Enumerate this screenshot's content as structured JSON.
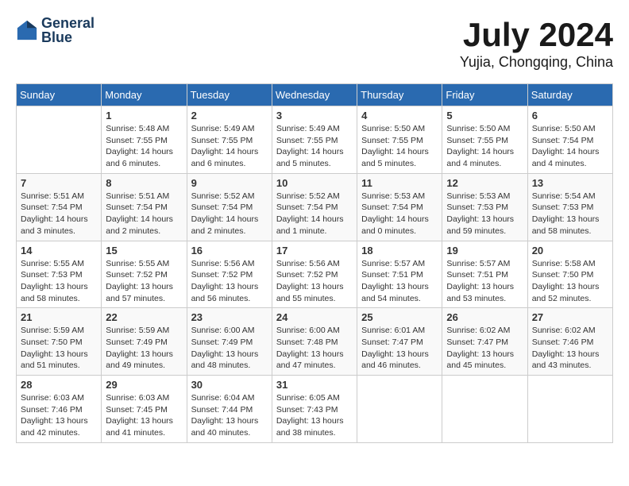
{
  "header": {
    "logo_line1": "General",
    "logo_line2": "Blue",
    "title": "July 2024",
    "subtitle": "Yujia, Chongqing, China"
  },
  "calendar": {
    "days_of_week": [
      "Sunday",
      "Monday",
      "Tuesday",
      "Wednesday",
      "Thursday",
      "Friday",
      "Saturday"
    ],
    "weeks": [
      [
        {
          "day": "",
          "info": ""
        },
        {
          "day": "1",
          "info": "Sunrise: 5:48 AM\nSunset: 7:55 PM\nDaylight: 14 hours\nand 6 minutes."
        },
        {
          "day": "2",
          "info": "Sunrise: 5:49 AM\nSunset: 7:55 PM\nDaylight: 14 hours\nand 6 minutes."
        },
        {
          "day": "3",
          "info": "Sunrise: 5:49 AM\nSunset: 7:55 PM\nDaylight: 14 hours\nand 5 minutes."
        },
        {
          "day": "4",
          "info": "Sunrise: 5:50 AM\nSunset: 7:55 PM\nDaylight: 14 hours\nand 5 minutes."
        },
        {
          "day": "5",
          "info": "Sunrise: 5:50 AM\nSunset: 7:55 PM\nDaylight: 14 hours\nand 4 minutes."
        },
        {
          "day": "6",
          "info": "Sunrise: 5:50 AM\nSunset: 7:54 PM\nDaylight: 14 hours\nand 4 minutes."
        }
      ],
      [
        {
          "day": "7",
          "info": "Sunrise: 5:51 AM\nSunset: 7:54 PM\nDaylight: 14 hours\nand 3 minutes."
        },
        {
          "day": "8",
          "info": "Sunrise: 5:51 AM\nSunset: 7:54 PM\nDaylight: 14 hours\nand 2 minutes."
        },
        {
          "day": "9",
          "info": "Sunrise: 5:52 AM\nSunset: 7:54 PM\nDaylight: 14 hours\nand 2 minutes."
        },
        {
          "day": "10",
          "info": "Sunrise: 5:52 AM\nSunset: 7:54 PM\nDaylight: 14 hours\nand 1 minute."
        },
        {
          "day": "11",
          "info": "Sunrise: 5:53 AM\nSunset: 7:54 PM\nDaylight: 14 hours\nand 0 minutes."
        },
        {
          "day": "12",
          "info": "Sunrise: 5:53 AM\nSunset: 7:53 PM\nDaylight: 13 hours\nand 59 minutes."
        },
        {
          "day": "13",
          "info": "Sunrise: 5:54 AM\nSunset: 7:53 PM\nDaylight: 13 hours\nand 58 minutes."
        }
      ],
      [
        {
          "day": "14",
          "info": "Sunrise: 5:55 AM\nSunset: 7:53 PM\nDaylight: 13 hours\nand 58 minutes."
        },
        {
          "day": "15",
          "info": "Sunrise: 5:55 AM\nSunset: 7:52 PM\nDaylight: 13 hours\nand 57 minutes."
        },
        {
          "day": "16",
          "info": "Sunrise: 5:56 AM\nSunset: 7:52 PM\nDaylight: 13 hours\nand 56 minutes."
        },
        {
          "day": "17",
          "info": "Sunrise: 5:56 AM\nSunset: 7:52 PM\nDaylight: 13 hours\nand 55 minutes."
        },
        {
          "day": "18",
          "info": "Sunrise: 5:57 AM\nSunset: 7:51 PM\nDaylight: 13 hours\nand 54 minutes."
        },
        {
          "day": "19",
          "info": "Sunrise: 5:57 AM\nSunset: 7:51 PM\nDaylight: 13 hours\nand 53 minutes."
        },
        {
          "day": "20",
          "info": "Sunrise: 5:58 AM\nSunset: 7:50 PM\nDaylight: 13 hours\nand 52 minutes."
        }
      ],
      [
        {
          "day": "21",
          "info": "Sunrise: 5:59 AM\nSunset: 7:50 PM\nDaylight: 13 hours\nand 51 minutes."
        },
        {
          "day": "22",
          "info": "Sunrise: 5:59 AM\nSunset: 7:49 PM\nDaylight: 13 hours\nand 49 minutes."
        },
        {
          "day": "23",
          "info": "Sunrise: 6:00 AM\nSunset: 7:49 PM\nDaylight: 13 hours\nand 48 minutes."
        },
        {
          "day": "24",
          "info": "Sunrise: 6:00 AM\nSunset: 7:48 PM\nDaylight: 13 hours\nand 47 minutes."
        },
        {
          "day": "25",
          "info": "Sunrise: 6:01 AM\nSunset: 7:47 PM\nDaylight: 13 hours\nand 46 minutes."
        },
        {
          "day": "26",
          "info": "Sunrise: 6:02 AM\nSunset: 7:47 PM\nDaylight: 13 hours\nand 45 minutes."
        },
        {
          "day": "27",
          "info": "Sunrise: 6:02 AM\nSunset: 7:46 PM\nDaylight: 13 hours\nand 43 minutes."
        }
      ],
      [
        {
          "day": "28",
          "info": "Sunrise: 6:03 AM\nSunset: 7:46 PM\nDaylight: 13 hours\nand 42 minutes."
        },
        {
          "day": "29",
          "info": "Sunrise: 6:03 AM\nSunset: 7:45 PM\nDaylight: 13 hours\nand 41 minutes."
        },
        {
          "day": "30",
          "info": "Sunrise: 6:04 AM\nSunset: 7:44 PM\nDaylight: 13 hours\nand 40 minutes."
        },
        {
          "day": "31",
          "info": "Sunrise: 6:05 AM\nSunset: 7:43 PM\nDaylight: 13 hours\nand 38 minutes."
        },
        {
          "day": "",
          "info": ""
        },
        {
          "day": "",
          "info": ""
        },
        {
          "day": "",
          "info": ""
        }
      ]
    ]
  }
}
